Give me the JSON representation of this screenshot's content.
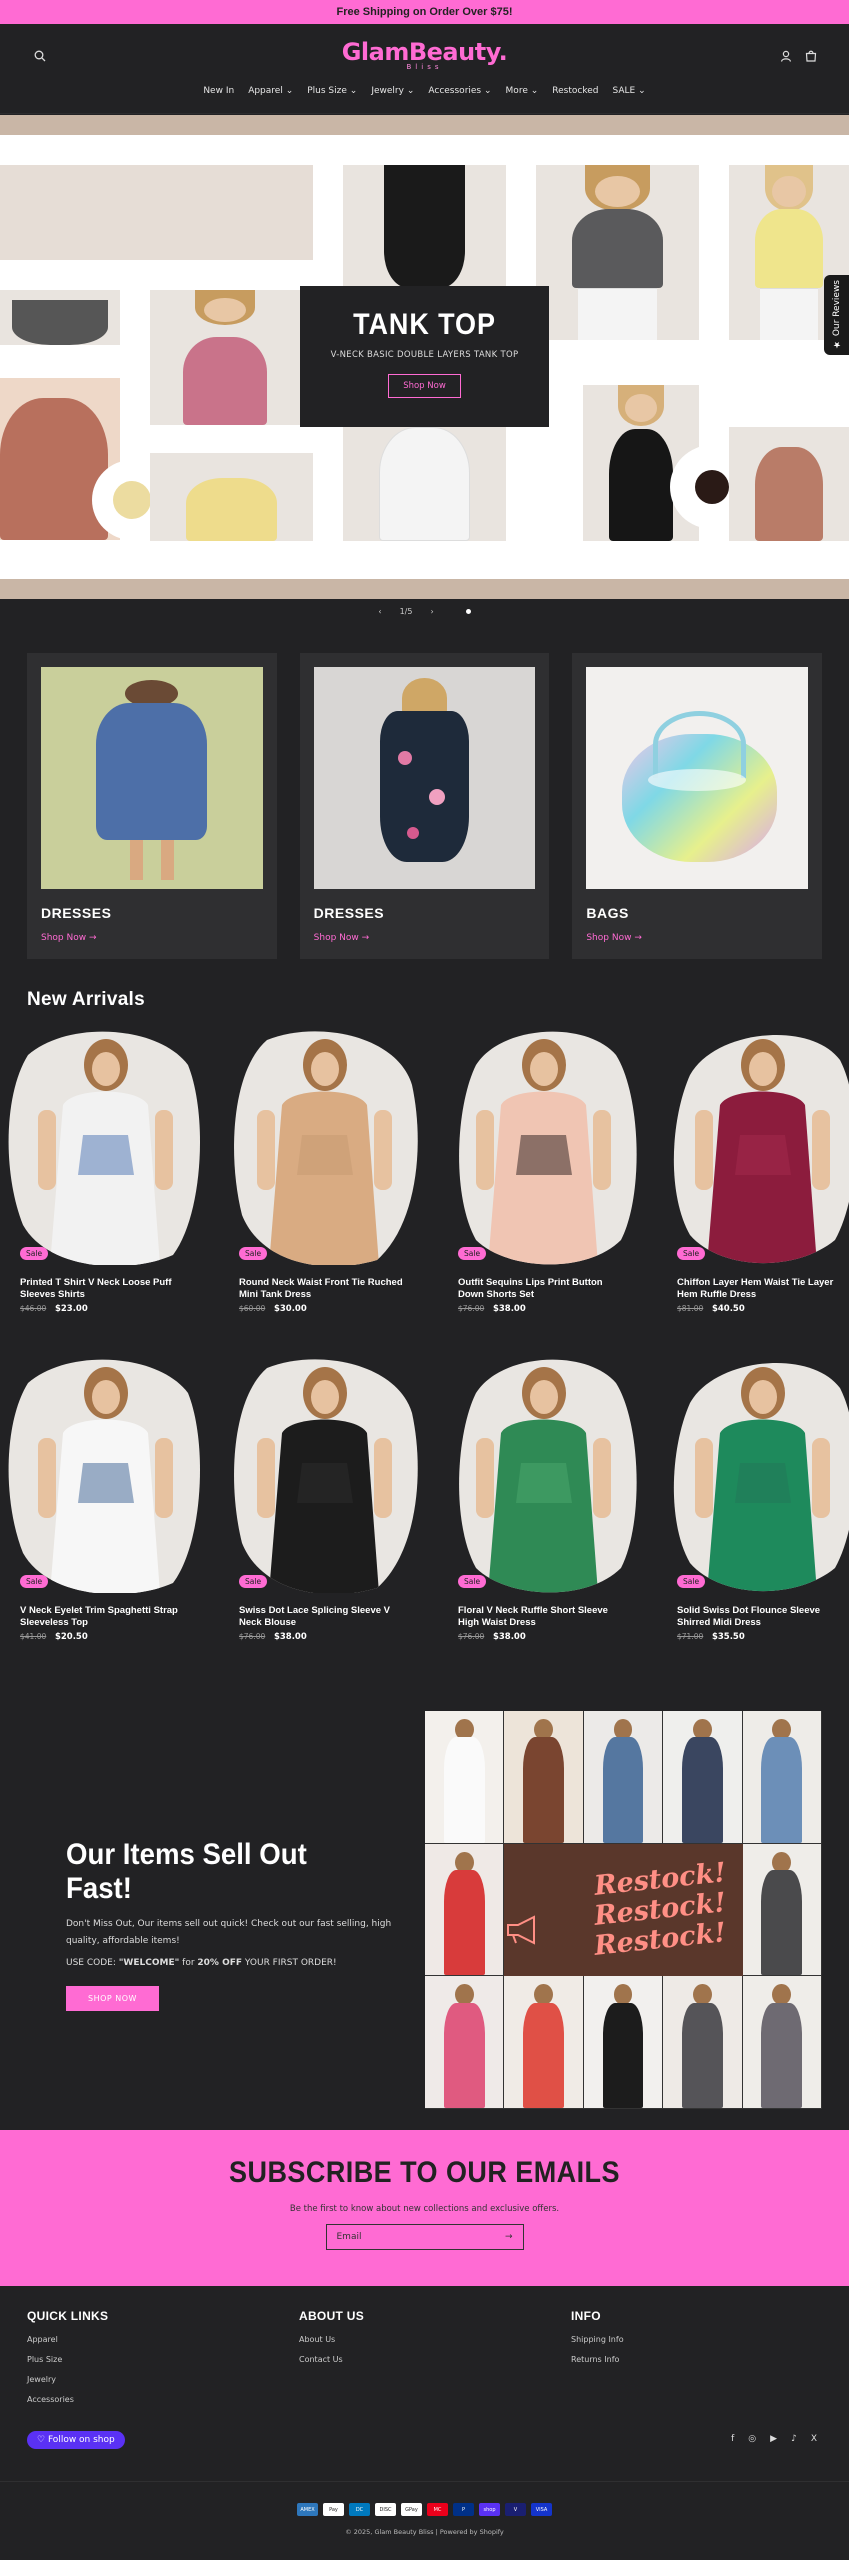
{
  "announcement": "Free Shipping on Order Over $75!",
  "header": {
    "logo_main": "GlamBeauty.",
    "logo_sub": "Bliss",
    "nav": [
      "New In",
      "Apparel",
      "Plus Size",
      "Jewelry",
      "Accessories",
      "More",
      "Restocked",
      "SALE"
    ],
    "icons": [
      "search-icon",
      "account-icon",
      "cart-icon"
    ]
  },
  "hero": {
    "title": "TANK TOP",
    "subtitle": "V-NECK BASIC DOUBLE LAYERS TANK TOP",
    "button": "Shop Now",
    "reviews_tab": "Our Reviews",
    "slide_counter": "1/5"
  },
  "collections": [
    {
      "title": "DRESSES",
      "link": "Shop Now"
    },
    {
      "title": "DRESSES",
      "link": "Shop Now"
    },
    {
      "title": "BAGS",
      "link": "Shop Now"
    }
  ],
  "new_arrivals": {
    "title": "New Arrivals",
    "badge": "Sale",
    "products": [
      {
        "name": "Printed T Shirt V Neck Loose Puff Sleeves Shirts",
        "old_price": "$46.00",
        "price": "$23.00",
        "color": "#f2f2f2",
        "accent": "#5a7db8"
      },
      {
        "name": "Round Neck Waist Front Tie Ruched Mini Tank Dress",
        "old_price": "$60.00",
        "price": "$30.00",
        "color": "#d9ab82",
        "accent": "#c79a72"
      },
      {
        "name": "Outfit Sequins Lips Print Button Down Shorts Set",
        "old_price": "$76.00",
        "price": "$38.00",
        "color": "#f0c5b3",
        "accent": "#3a2a28"
      },
      {
        "name": "Chiffon Layer Hem Waist Tie Layer Hem Ruffle Dress",
        "old_price": "$81.00",
        "price": "$40.50",
        "color": "#8c1c3d",
        "accent": "#a32a4c"
      },
      {
        "name": "V Neck Eyelet Trim Spaghetti Strap Sleeveless Top",
        "old_price": "$41.00",
        "price": "$20.50",
        "color": "#f7f7f7",
        "accent": "#4d6f9c"
      },
      {
        "name": "Swiss Dot Lace Splicing Sleeve V Neck Blouse",
        "old_price": "$76.00",
        "price": "$38.00",
        "color": "#1c1c1c",
        "accent": "#2b2b2b"
      },
      {
        "name": "Floral V Neck Ruffle Short Sleeve High Waist Dress",
        "old_price": "$76.00",
        "price": "$38.00",
        "color": "#2f8a55",
        "accent": "#48a56b"
      },
      {
        "name": "Solid Swiss Dot Flounce Sleeve Shirred Midi Dress",
        "old_price": "$71.00",
        "price": "$35.50",
        "color": "#1e8a5c",
        "accent": "#22795a"
      }
    ]
  },
  "sellout": {
    "title": "Our Items Sell Out Fast!",
    "body": "Don't Miss Out, Our items sell out quick! Check out our fast selling, high quality, affordable items!",
    "code_prefix": "USE CODE: ",
    "code": "\"WELCOME\"",
    "code_mid": " for ",
    "code_pct": "20% OFF",
    "code_suffix": " YOUR FIRST ORDER!",
    "button": "SHOP NOW",
    "restock": [
      "Restock!",
      "Restock!",
      "Restock!"
    ]
  },
  "subscribe": {
    "title": "SUBSCRIBE TO OUR EMAILS",
    "text": "Be the first to know about new collections and exclusive offers.",
    "placeholder": "Email"
  },
  "footer": {
    "quick_links_title": "QUICK LINKS",
    "quick_links": [
      "Apparel",
      "Plus Size",
      "Jewelry",
      "Accessories"
    ],
    "about_title": "ABOUT US",
    "about_links": [
      "About Us",
      "Contact Us"
    ],
    "info_title": "INFO",
    "info_links": [
      "Shipping Info",
      "Returns Info"
    ],
    "follow": "Follow on shop",
    "socials": [
      "f",
      "◎",
      "▶",
      "♪",
      "X"
    ],
    "payments": [
      "AMEX",
      "Pay",
      "DC",
      "DISC",
      "GPay",
      "MC",
      "P",
      "shop",
      "V",
      "VISA"
    ],
    "copyright": "© 2025, Glam Beauty Bliss | Powered by Shopify"
  }
}
